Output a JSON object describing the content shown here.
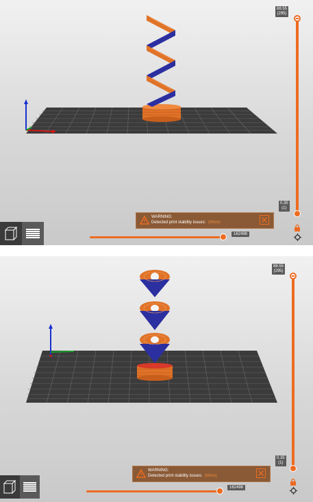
{
  "panels": [
    {
      "id": "top",
      "vertical_slider": {
        "top_value": "88.55",
        "top_layer": "(295)",
        "bottom_value": "0.35",
        "bottom_layer": "(1)"
      },
      "horizontal_slider": {
        "move_value": "162498"
      },
      "warning": {
        "title": "WARNING:",
        "message": "Detected print stability issues:",
        "link": "(More)"
      }
    },
    {
      "id": "bottom",
      "vertical_slider": {
        "top_value": "88.55",
        "top_layer": "(295)",
        "bottom_value": "0.35",
        "bottom_layer": "(1)"
      },
      "horizontal_slider": {
        "move_value": "162498"
      },
      "warning": {
        "title": "WARNING:",
        "message": "Detected print stability issues:",
        "link": "(More)"
      }
    }
  ],
  "icons": {
    "view_3d": "cube-icon",
    "view_preview": "layers-icon",
    "warning": "warning-triangle-icon",
    "close": "close-x-icon",
    "cog": "cog-icon",
    "lock": "lock-icon"
  },
  "colors": {
    "accent": "#ed6b21",
    "extrusion": "#e07328",
    "overhang": "#2b2fa0",
    "bed": "#3b3b3b",
    "warning_bg": "#8a5a36",
    "axis_x": "#d01818",
    "axis_y": "#1aa02a",
    "axis_z": "#1830d0"
  }
}
